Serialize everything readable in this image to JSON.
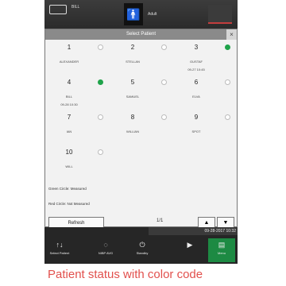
{
  "topbar": {
    "bed_label": "BILL",
    "age_type": "Adult"
  },
  "dialog": {
    "title": "Select Patient",
    "close": "×",
    "beds": [
      {
        "num": "1",
        "name": "ALEXANDER",
        "time": "",
        "measured": false
      },
      {
        "num": "2",
        "name": "STELLAN",
        "time": "",
        "measured": false
      },
      {
        "num": "3",
        "name": "GUSTAF",
        "time": "09-27 10:45",
        "measured": true
      },
      {
        "num": "4",
        "name": "BILL",
        "time": "09-28 10:30",
        "measured": true
      },
      {
        "num": "5",
        "name": "SAMUEL",
        "time": "",
        "measured": false
      },
      {
        "num": "6",
        "name": "ELVA",
        "time": "",
        "measured": false
      },
      {
        "num": "7",
        "name": "IAN",
        "time": "",
        "measured": false
      },
      {
        "num": "8",
        "name": "WILLIAN",
        "time": "",
        "measured": false
      },
      {
        "num": "9",
        "name": "SPOT",
        "time": "",
        "measured": false
      },
      {
        "num": "10",
        "name": "WILL",
        "time": "",
        "measured": false
      }
    ],
    "legend_green": "Green Circle: Measured",
    "legend_red": "Red Circle: Not Measured",
    "refresh_label": "Refresh",
    "page_indicator": "1/1",
    "page_up": "▲",
    "page_down": "▼"
  },
  "bottom": {
    "datetime": "09-28-2017 10:32",
    "buttons": [
      {
        "label": "Select Patient",
        "icon": "↑↓"
      },
      {
        "label": "NIBP AVG",
        "icon": "◌"
      },
      {
        "label": "Standby",
        "icon": "⏻"
      },
      {
        "label": "",
        "icon": "▶"
      },
      {
        "label": "Menu",
        "icon": "▤"
      }
    ]
  },
  "caption": "Patient status with color code",
  "colors": {
    "measured": "#1fa34a",
    "caption": "#e2504d"
  }
}
